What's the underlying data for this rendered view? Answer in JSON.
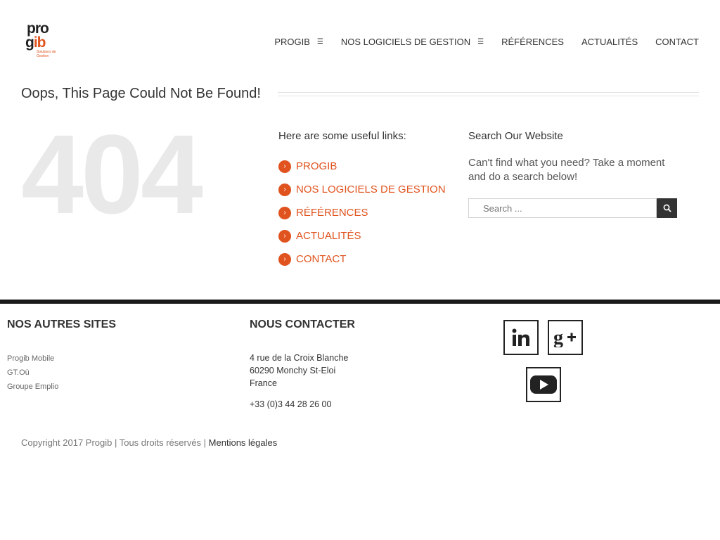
{
  "logo": {
    "line1": "pro",
    "line2a": "g",
    "line2b": "ib",
    "tagline": "Solutions de Gestion"
  },
  "nav": [
    {
      "label": "PROGIB",
      "has_dropdown": true
    },
    {
      "label": "NOS LOGICIELS DE GESTION",
      "has_dropdown": true
    },
    {
      "label": "RÉFÉRENCES",
      "has_dropdown": false
    },
    {
      "label": "ACTUALITÉS",
      "has_dropdown": false
    },
    {
      "label": "CONTACT",
      "has_dropdown": false
    }
  ],
  "main": {
    "title": "Oops, This Page Could Not Be Found!",
    "code": "404",
    "links_heading": "Here are some useful links:",
    "links": [
      "PROGIB",
      "NOS LOGICIELS DE GESTION",
      "RÉFÉRENCES",
      "ACTUALITÉS",
      "CONTACT"
    ],
    "search_heading": "Search Our Website",
    "search_text": "Can't find what you need? Take a moment and do a search below!",
    "search_placeholder": "Search ...",
    "search_icon": "search-icon"
  },
  "footer": {
    "sites_heading": "NOS AUTRES SITES",
    "sites": [
      "Progib Mobile",
      "GT.Où",
      "Groupe Emplio"
    ],
    "contact_heading": "NOUS CONTACTER",
    "address": [
      "4 rue de la Croix Blanche",
      "60290 Monchy St-Eloi",
      "France"
    ],
    "phone": "+33 (0)3 44 28 26 00",
    "social": [
      "linkedin-icon",
      "google-plus-icon",
      "youtube-icon"
    ],
    "copyright": "Copyright 2017 Progib | Tous droits réservés |",
    "legal_link": "Mentions légales"
  },
  "colors": {
    "accent": "#e0531e",
    "dark": "#1a1a1a",
    "muted_404": "#e9e9e9"
  }
}
